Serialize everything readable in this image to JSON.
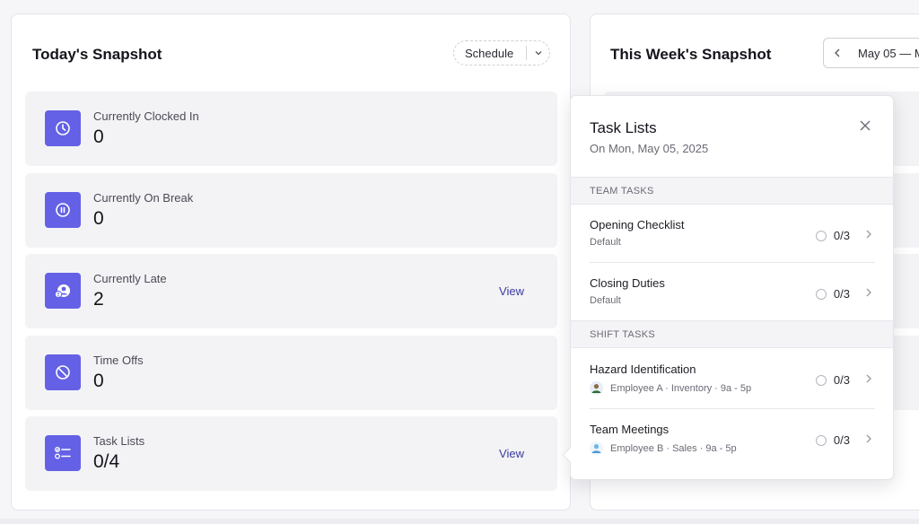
{
  "today": {
    "title": "Today's Snapshot",
    "schedule_label": "Schedule",
    "cards": [
      {
        "label": "Currently Clocked In",
        "value": "0",
        "link": "",
        "icon": "clock-icon"
      },
      {
        "label": "Currently On Break",
        "value": "0",
        "link": "",
        "icon": "pause-icon"
      },
      {
        "label": "Currently Late",
        "value": "2",
        "link": "View",
        "icon": "late-user-icon"
      },
      {
        "label": "Time Offs",
        "value": "0",
        "link": "",
        "icon": "ban-icon"
      },
      {
        "label": "Task Lists",
        "value": "0/4",
        "link": "View",
        "icon": "checklist-icon"
      }
    ]
  },
  "week": {
    "title": "This Week's Snapshot",
    "date_range": "May 05 — M"
  },
  "popover": {
    "title": "Task Lists",
    "subtitle": "On Mon, May 05, 2025",
    "team_header": "TEAM TASKS",
    "shift_header": "SHIFT TASKS",
    "team_tasks": [
      {
        "name": "Opening Checklist",
        "sub": "Default",
        "progress": "0/3"
      },
      {
        "name": "Closing Duties",
        "sub": "Default",
        "progress": "0/3"
      }
    ],
    "shift_tasks": [
      {
        "name": "Hazard Identification",
        "sub": "Employee A · Inventory · 9a - 5p",
        "progress": "0/3"
      },
      {
        "name": "Team Meetings",
        "sub": "Employee B · Sales · 9a - 5p",
        "progress": "0/3"
      }
    ]
  },
  "colors": {
    "accent": "#6461e6",
    "link": "#3a3aa0",
    "card_bg": "#f3f3f6"
  }
}
